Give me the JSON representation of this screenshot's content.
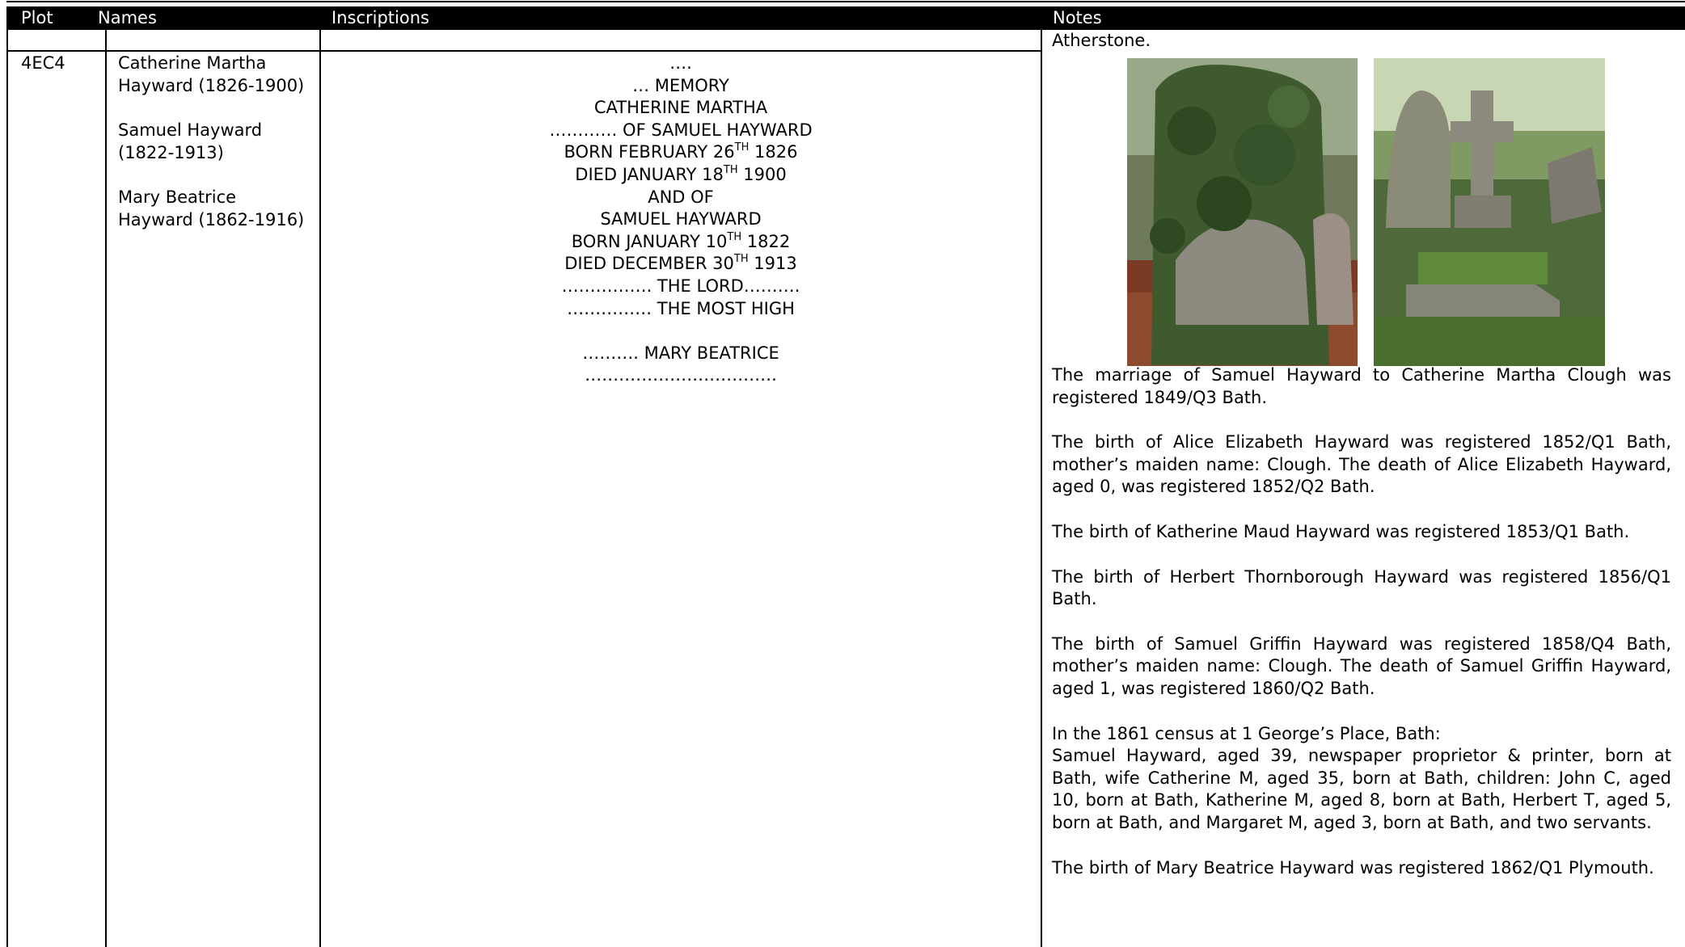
{
  "table": {
    "headers": {
      "plot": "Plot",
      "names": "Names",
      "inscriptions": "Inscriptions",
      "notes": "Notes"
    },
    "carryover_note": "Atherstone.",
    "row": {
      "plot": "4EC4",
      "names": [
        "Catherine Martha Hayward (1826-1900)",
        "Samuel Hayward (1822-1913)",
        "Mary Beatrice Hayward (1862-1916)"
      ],
      "inscription": {
        "l1": "….",
        "l2": "… MEMORY",
        "l3": "CATHERINE MARTHA",
        "l4": "………… OF SAMUEL HAYWARD",
        "l5_pre": "BORN FEBRUARY 26",
        "l5_sup": "TH",
        "l5_post": " 1826",
        "l6_pre": "DIED JANUARY 18",
        "l6_sup": "TH",
        "l6_post": " 1900",
        "l7": "AND OF",
        "l8": "SAMUEL HAYWARD",
        "l9_pre": "BORN JANUARY 10",
        "l9_sup": "TH",
        "l9_post": " 1822",
        "l10_pre": "DIED DECEMBER 30",
        "l10_sup": "TH",
        "l10_post": " 1913",
        "l11": "……………. THE LORD……….",
        "l12": "…………… THE MOST HIGH",
        "l13": "………. MARY BEATRICE",
        "l14": "……………………………."
      },
      "notes": [
        "The marriage of Samuel Hayward to Catherine Martha Clough was registered 1849/Q3 Bath.",
        "The birth of Alice Elizabeth Hayward was registered 1852/Q1 Bath, mother’s maiden name: Clough. The death of Alice Elizabeth Hayward, aged 0, was registered 1852/Q2 Bath.",
        "The birth of Katherine Maud Hayward was registered 1853/Q1 Bath.",
        "The birth of Herbert Thornborough Hayward was registered 1856/Q1 Bath.",
        "The birth of Samuel Griffin Hayward was registered 1858/Q4 Bath, mother’s maiden name: Clough. The death of Samuel Griffin Hayward, aged 1, was registered 1860/Q2 Bath.",
        "In the 1861 census at 1 George’s Place, Bath:",
        "Samuel Hayward, aged 39, newspaper proprietor & printer, born at Bath, wife Catherine M, aged 35, born at Bath, children: John C, aged 10, born at Bath, Katherine M, aged 8, born at Bath, Herbert T, aged 5, born at Bath, and Margaret M, aged 3, born at Bath, and two servants.",
        "The birth of Mary Beatrice Hayward was registered 1862/Q1 Plymouth."
      ]
    }
  },
  "photos": [
    "ivy-covered-headstone-photo",
    "headstone-and-cross-photo"
  ],
  "colors": {
    "header_bg": "#000000",
    "header_text": "#ffffff",
    "rule": "#000000"
  }
}
